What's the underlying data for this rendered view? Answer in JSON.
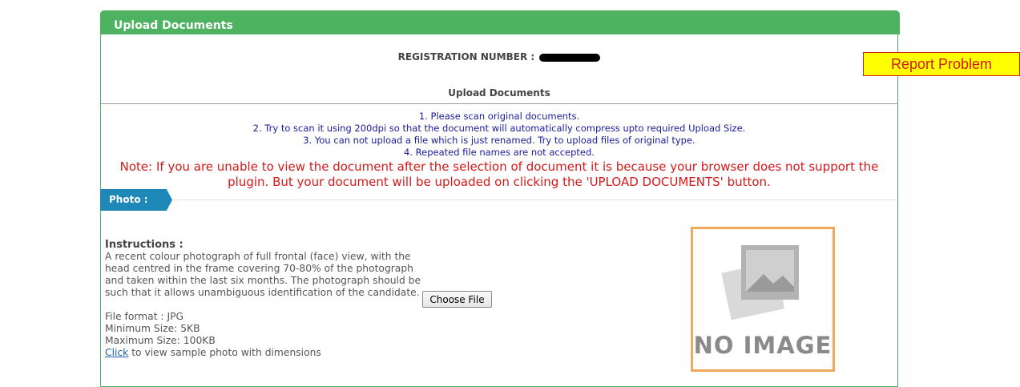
{
  "header": {
    "title": "Upload Documents"
  },
  "registration": {
    "label": "REGISTRATION NUMBER :"
  },
  "subtitle": "Upload Documents",
  "notes": [
    "1. Please scan original documents.",
    "2. Try to scan it using 200dpi so that the document will automatically compress upto required Upload Size.",
    "3. You can not upload a file which is just renamed. Try to upload files of original type.",
    "4. Repeated file names are not accepted."
  ],
  "warning": "Note: If you are unable to view the document after the selection of document it is because your browser does not support the plugin. But your document will be uploaded on clicking the 'UPLOAD DOCUMENTS' button.",
  "photo_section": {
    "tab_label": "Photo :",
    "instructions_title": "Instructions :",
    "instructions_text": "A recent colour photograph of full frontal (face) view, with the head centred in the frame covering 70-80% of the photograph and taken within the last six months. The photograph should be such that it allows unambiguous identification of the candidate.",
    "file_format": "File format : JPG",
    "min_size": "Minimum Size: 5KB",
    "max_size": "Maximum Size: 100KB",
    "click_link": "Click",
    "click_rest": " to view sample photo with dimensions",
    "choose_file_label": "Choose File",
    "no_image_text": "NO IMAGE"
  },
  "report_button": "Report Problem",
  "colors": {
    "header_green": "#4db361",
    "tab_blue": "#1e88b9",
    "note_red": "#d41a1a",
    "notes_blue": "#1a1a9e",
    "report_yellow": "#ffff00",
    "placeholder_border": "#f0a85a"
  }
}
